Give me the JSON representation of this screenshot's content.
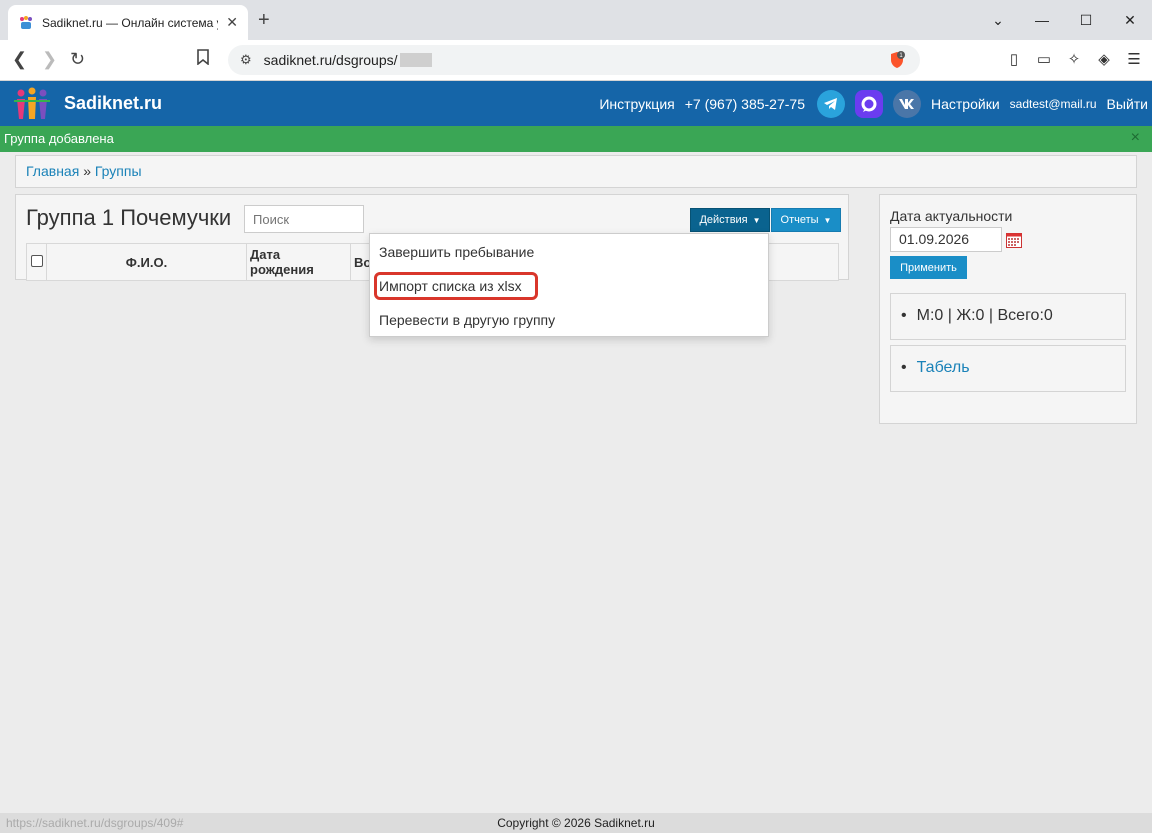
{
  "browser": {
    "tab_title": "Sadiknet.ru — Онлайн система у",
    "url": "sadiknet.ru/dsgroups/",
    "status_url": "https://sadiknet.ru/dsgroups/409#",
    "extension_badge": "1"
  },
  "header": {
    "brand": "Sadiknet.ru",
    "instructions": "Инструкция",
    "phone": "+7 (967) 385-27-75",
    "settings": "Настройки",
    "email": "sadtest@mail.ru",
    "logout": "Выйти"
  },
  "alert": {
    "message": "Группа добавлена",
    "close": "×"
  },
  "breadcrumb": {
    "home": "Главная",
    "separator": "»",
    "current": "Группы"
  },
  "main": {
    "title": "Группа 1 Почемучки",
    "search_placeholder": "Поиск",
    "actions_button": "Действия",
    "reports_button": "Отчеты",
    "columns": [
      "Ф.И.О.",
      "Дата рождения",
      "Во"
    ]
  },
  "dropdown": {
    "items": [
      "Завершить пребывание",
      "Импорт списка из xlsx",
      "Перевести в другую группу"
    ]
  },
  "sidebar": {
    "date_label": "Дата актуальности",
    "date_value": "01.09.2026",
    "apply_button": "Применить",
    "stats": "М:0 | Ж:0 | Всего:0",
    "tabel_link": "Табель"
  },
  "footer": {
    "copyright": "Copyright © 2026 Sadiknet.ru"
  },
  "colors": {
    "header_bg": "#1565a8",
    "alert_bg": "#3aa655",
    "link": "#1a82b8",
    "highlight": "#d9362b"
  }
}
